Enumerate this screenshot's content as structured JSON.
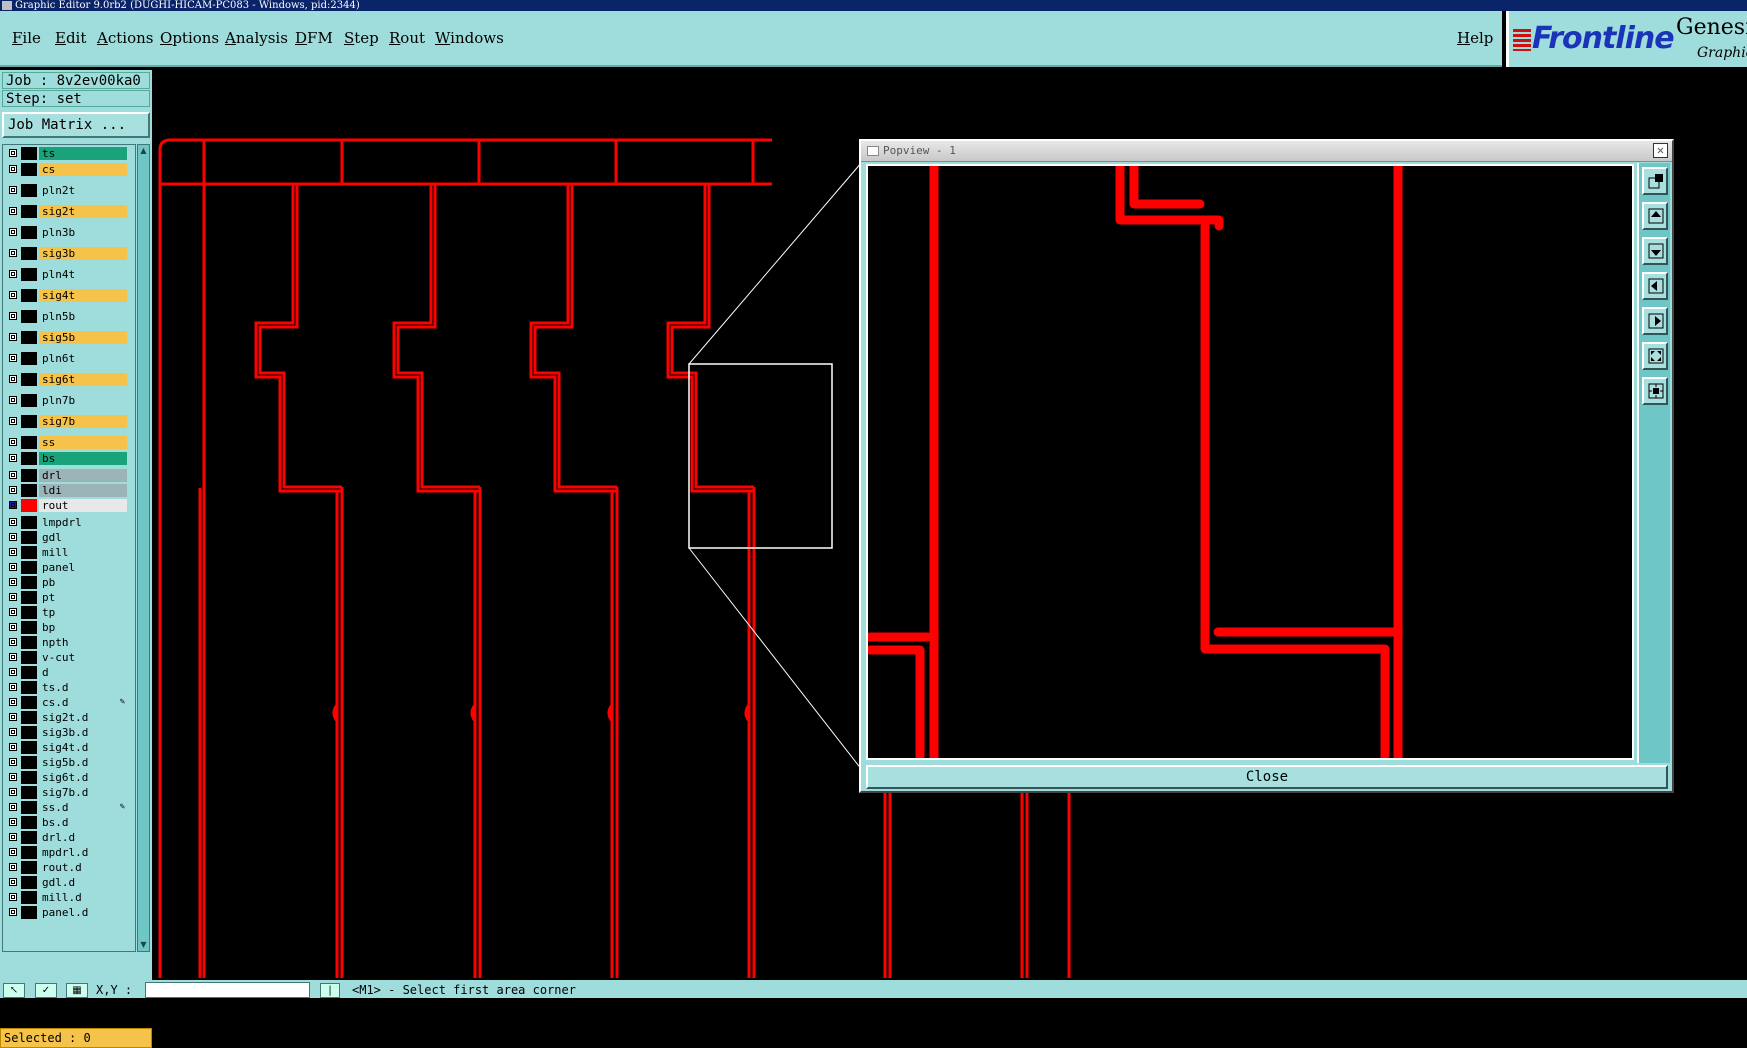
{
  "window": {
    "title": "Graphic Editor 9.0rb2 (DUGHI-HICAM-PC083 - Windows, pid:2344)"
  },
  "menu": {
    "items": [
      "File",
      "Edit",
      "Actions",
      "Options",
      "Analysis",
      "DFM",
      "Step",
      "Rout",
      "Windows"
    ],
    "help": "Help"
  },
  "logo": {
    "brand": "Frontline",
    "product": "Genesi",
    "subtitle": "Graphic"
  },
  "job": {
    "label": "Job : 8v2ev00ka0",
    "step": "Step: set",
    "matrix_button": "Job Matrix ..."
  },
  "layers": [
    {
      "name": "ts",
      "color": "#1aa37a"
    },
    {
      "name": "cs",
      "color": "#f5c34a"
    },
    {
      "name": "pln2t",
      "color": "#9fdcdc"
    },
    {
      "name": "sig2t",
      "color": "#f5c34a"
    },
    {
      "name": "pln3b",
      "color": "#9fdcdc"
    },
    {
      "name": "sig3b",
      "color": "#f5c34a"
    },
    {
      "name": "pln4t",
      "color": "#9fdcdc"
    },
    {
      "name": "sig4t",
      "color": "#f5c34a"
    },
    {
      "name": "pln5b",
      "color": "#9fdcdc"
    },
    {
      "name": "sig5b",
      "color": "#f5c34a"
    },
    {
      "name": "pln6t",
      "color": "#9fdcdc"
    },
    {
      "name": "sig6t",
      "color": "#f5c34a"
    },
    {
      "name": "pln7b",
      "color": "#9fdcdc"
    },
    {
      "name": "sig7b",
      "color": "#f5c34a"
    },
    {
      "name": "ss",
      "color": "#f5c34a"
    },
    {
      "name": "bs",
      "color": "#1aa37a"
    },
    {
      "name": "drl",
      "color": "#9ab4b8"
    },
    {
      "name": "ldi",
      "color": "#9ab4b8"
    },
    {
      "name": "rout",
      "color": "#e8e8e8",
      "active": true
    },
    {
      "name": "lmpdrl",
      "color": "#9fdcdc"
    },
    {
      "name": "gdl",
      "color": "#9fdcdc"
    },
    {
      "name": "mill",
      "color": "#9fdcdc"
    },
    {
      "name": "panel",
      "color": "#9fdcdc"
    },
    {
      "name": "pb",
      "color": "#9fdcdc"
    },
    {
      "name": "pt",
      "color": "#9fdcdc"
    },
    {
      "name": "tp",
      "color": "#9fdcdc"
    },
    {
      "name": "bp",
      "color": "#9fdcdc"
    },
    {
      "name": "npth",
      "color": "#9fdcdc"
    },
    {
      "name": "v-cut",
      "color": "#9fdcdc"
    },
    {
      "name": "d",
      "color": "#9fdcdc"
    },
    {
      "name": "ts.d",
      "color": "#9fdcdc"
    },
    {
      "name": "cs.d",
      "color": "#9fdcdc",
      "mark": "✎"
    },
    {
      "name": "sig2t.d",
      "color": "#9fdcdc"
    },
    {
      "name": "sig3b.d",
      "color": "#9fdcdc"
    },
    {
      "name": "sig4t.d",
      "color": "#9fdcdc"
    },
    {
      "name": "sig5b.d",
      "color": "#9fdcdc"
    },
    {
      "name": "sig6t.d",
      "color": "#9fdcdc"
    },
    {
      "name": "sig7b.d",
      "color": "#9fdcdc"
    },
    {
      "name": "ss.d",
      "color": "#9fdcdc",
      "mark": "✎"
    },
    {
      "name": "bs.d",
      "color": "#9fdcdc"
    },
    {
      "name": "drl.d",
      "color": "#9fdcdc"
    },
    {
      "name": "mpdrl.d",
      "color": "#9fdcdc"
    },
    {
      "name": "rout.d",
      "color": "#9fdcdc"
    },
    {
      "name": "gdl.d",
      "color": "#9fdcdc"
    },
    {
      "name": "mill.d",
      "color": "#9fdcdc"
    },
    {
      "name": "panel.d",
      "color": "#9fdcdc"
    }
  ],
  "selected": "Selected : 0",
  "status": {
    "xy_label": "X,Y :",
    "xy_value": "",
    "prompt": "<M1> - Select first area corner"
  },
  "popview": {
    "title": "Popview - 1",
    "close_label": "Close",
    "close_x": "✕"
  },
  "colors": {
    "trace": "#ff0000",
    "panel_bg": "#9fdcdc",
    "canvas_bg": "#000000"
  }
}
